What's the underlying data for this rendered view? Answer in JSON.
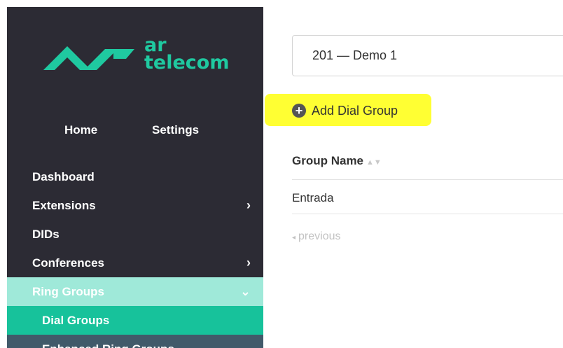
{
  "logo": {
    "line1": "ar",
    "line2": "telecom"
  },
  "top_nav": {
    "home": "Home",
    "settings": "Settings"
  },
  "menu": {
    "items": [
      {
        "label": "Dashboard",
        "chevron": ""
      },
      {
        "label": "Extensions",
        "chevron": "›"
      },
      {
        "label": "DIDs",
        "chevron": ""
      },
      {
        "label": "Conferences",
        "chevron": "›"
      },
      {
        "label": "Ring Groups",
        "chevron": "⌄"
      },
      {
        "label": "Dial Groups",
        "chevron": ""
      },
      {
        "label": "Enhanced Ring Groups",
        "chevron": ""
      }
    ]
  },
  "selector": {
    "value": "201  —  Demo 1"
  },
  "actions": {
    "add_icon": "+",
    "add_label": "Add Dial Group"
  },
  "table": {
    "header": "Group Name",
    "sort_arrows": "▲▼",
    "rows": [
      "Entrada"
    ]
  },
  "pagination": {
    "prev_icon": "◂",
    "prev_label": "previous"
  },
  "colors": {
    "sidebar_bg": "#2c2b34",
    "brand": "#1fc9a0",
    "active_parent": "#9fe9d9",
    "active_item": "#17c29b",
    "highlight": "#ffff33"
  }
}
